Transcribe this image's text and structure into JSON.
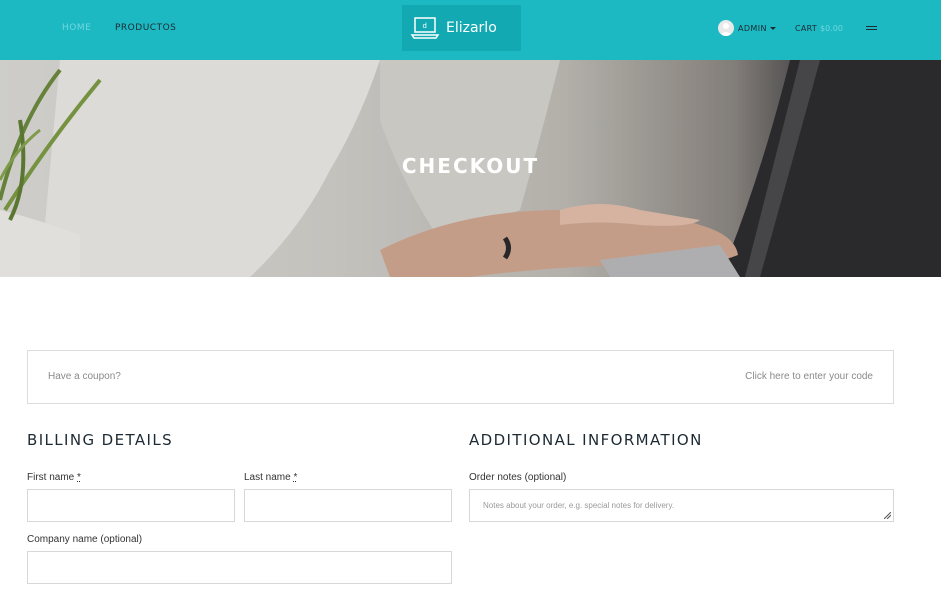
{
  "header": {
    "nav": [
      {
        "label": "HOME"
      },
      {
        "label": "PRODUCTOS"
      }
    ],
    "logo_text": "Elizarlo",
    "user_label": "ADMIN",
    "cart_label": "CART",
    "cart_amount": "$0.00",
    "colors": {
      "bar": "#1cb9c3",
      "logo_bg": "#13a9b3",
      "active_link": "#6fd7de"
    }
  },
  "hero": {
    "title": "CHECKOUT"
  },
  "coupon": {
    "text": "Have a coupon?",
    "link": "Click here to enter your code"
  },
  "billing": {
    "heading": "BILLING DETAILS",
    "first_name_label": "First name",
    "last_name_label": "Last name",
    "company_label": "Company name (optional)",
    "required_mark": "*",
    "first_name_value": "",
    "last_name_value": "",
    "company_value": ""
  },
  "additional": {
    "heading": "ADDITIONAL INFORMATION",
    "notes_label": "Order notes (optional)",
    "notes_placeholder": "Notes about your order, e.g. special notes for delivery.",
    "notes_value": ""
  }
}
